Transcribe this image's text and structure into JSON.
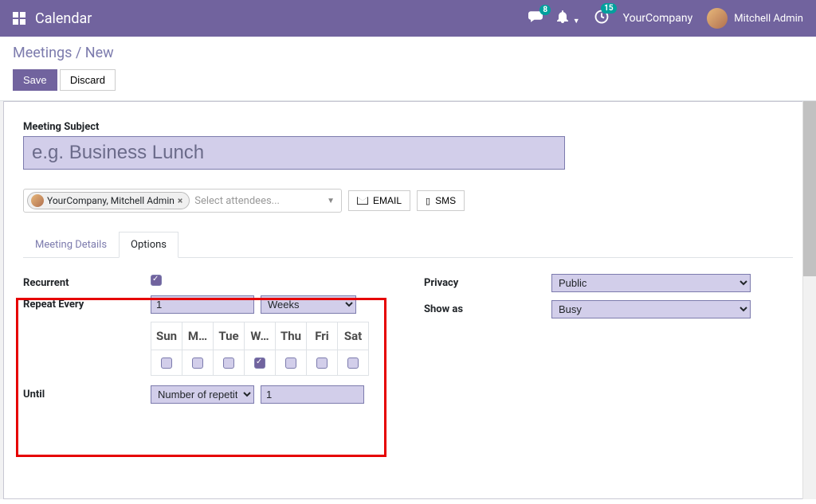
{
  "navbar": {
    "app_title": "Calendar",
    "chat_badge": "8",
    "activities_badge": "15",
    "company": "YourCompany",
    "user": "Mitchell Admin"
  },
  "breadcrumb": {
    "parent": "Meetings",
    "sep": " / ",
    "current": "New"
  },
  "buttons": {
    "save": "Save",
    "discard": "Discard",
    "email": "EMAIL",
    "sms": "SMS"
  },
  "subject": {
    "label": "Meeting Subject",
    "placeholder": "e.g. Business Lunch"
  },
  "attendees": {
    "tag": "YourCompany, Mitchell Admin",
    "placeholder": "Select attendees..."
  },
  "tabs": {
    "details": "Meeting Details",
    "options": "Options"
  },
  "options": {
    "recurrent_label": "Recurrent",
    "repeat_label": "Repeat Every",
    "repeat_value": "1",
    "repeat_unit": "Weeks",
    "until_label": "Until",
    "until_type": "Number of repetitions",
    "until_value": "1",
    "privacy_label": "Privacy",
    "privacy_value": "Public",
    "showas_label": "Show as",
    "showas_value": "Busy"
  },
  "days": {
    "sun": "Sun",
    "mon": "M…",
    "tue": "Tue",
    "wed": "W…",
    "thu": "Thu",
    "fri": "Fri",
    "sat": "Sat"
  }
}
